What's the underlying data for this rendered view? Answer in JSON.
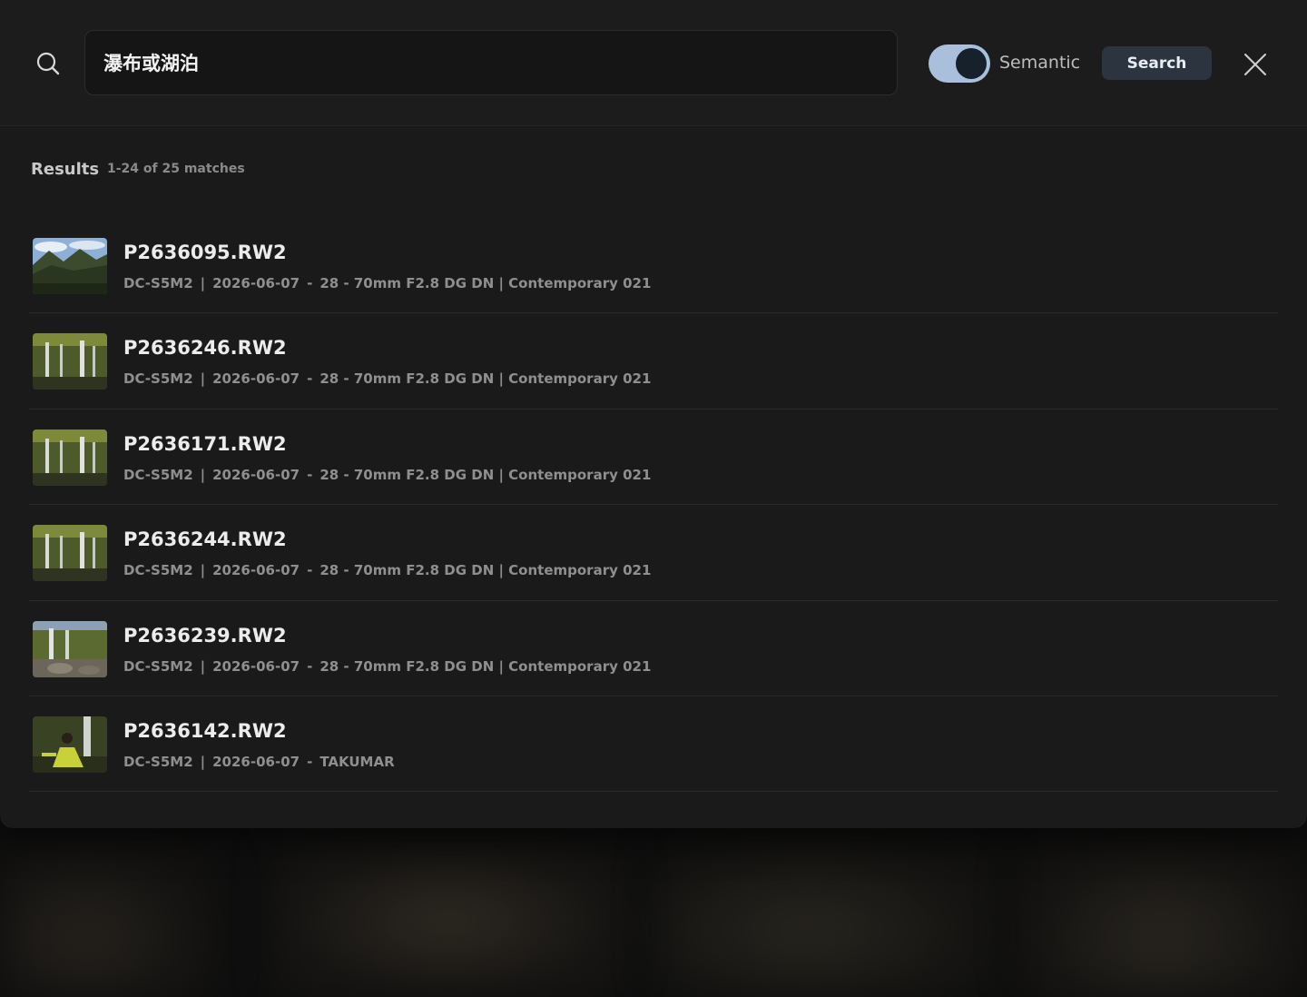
{
  "search": {
    "query": "瀑布或湖泊",
    "semantic_label": "Semantic",
    "semantic_enabled": true,
    "button_label": "Search"
  },
  "results": {
    "title": "Results",
    "count_text": "1-24 of 25 matches",
    "items": [
      {
        "filename": "P2636095.RW2",
        "camera": "DC-S5M2",
        "date": "2026-06-07",
        "lens": "28 - 70mm F2.8 DG DN | Contemporary 021",
        "thumb": "mountain-forest"
      },
      {
        "filename": "P2636246.RW2",
        "camera": "DC-S5M2",
        "date": "2026-06-07",
        "lens": "28 - 70mm F2.8 DG DN | Contemporary 021",
        "thumb": "waterfall-moss"
      },
      {
        "filename": "P2636171.RW2",
        "camera": "DC-S5M2",
        "date": "2026-06-07",
        "lens": "28 - 70mm F2.8 DG DN | Contemporary 021",
        "thumb": "waterfall-moss"
      },
      {
        "filename": "P2636244.RW2",
        "camera": "DC-S5M2",
        "date": "2026-06-07",
        "lens": "28 - 70mm F2.8 DG DN | Contemporary 021",
        "thumb": "waterfall-moss"
      },
      {
        "filename": "P2636239.RW2",
        "camera": "DC-S5M2",
        "date": "2026-06-07",
        "lens": "28 - 70mm F2.8 DG DN | Contemporary 021",
        "thumb": "waterfall-rocks"
      },
      {
        "filename": "P2636142.RW2",
        "camera": "DC-S5M2",
        "date": "2026-06-07",
        "lens": "TAKUMAR",
        "thumb": "person-waterfall"
      }
    ]
  },
  "colors": {
    "toggle_track": "#a9bfdc",
    "toggle_knob": "#17212c",
    "search_button": "#2c3440"
  }
}
